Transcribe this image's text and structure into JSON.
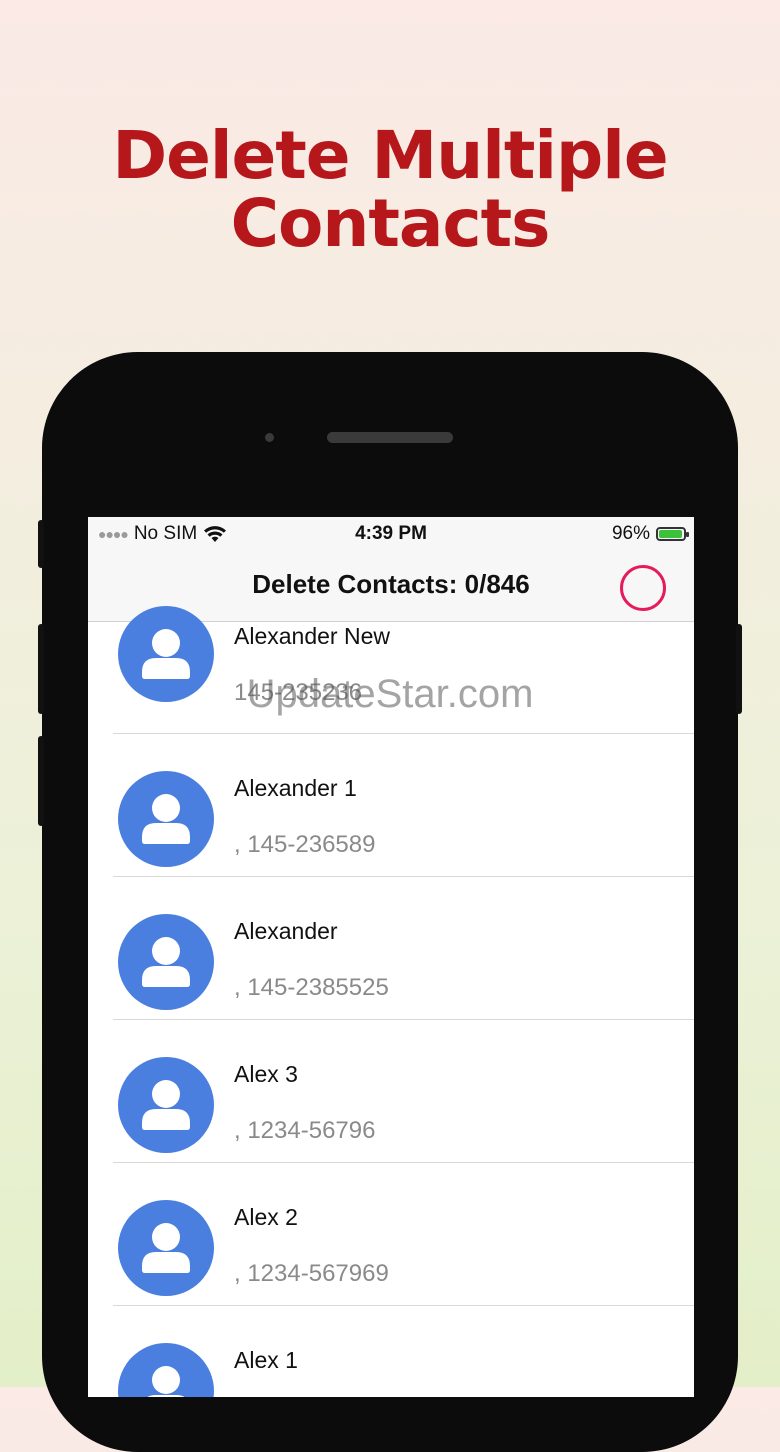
{
  "headline": {
    "line1": "Delete Multiple",
    "line2": "Contacts"
  },
  "status_bar": {
    "carrier": "No SIM",
    "time": "4:39 PM",
    "battery": "96%",
    "battery_level": 0.96
  },
  "nav": {
    "title": "Delete Contacts: 0/846",
    "select_all_icon": "circle-icon"
  },
  "contacts": [
    {
      "name": "Alexander New",
      "phone": "145-235236"
    },
    {
      "name": "Alexander 1",
      "phone": ", 145-236589"
    },
    {
      "name": "Alexander",
      "phone": ", 145-2385525"
    },
    {
      "name": "Alex 3",
      "phone": ", 1234-56796"
    },
    {
      "name": "Alex 2",
      "phone": ", 1234-567969"
    },
    {
      "name": "Alex 1",
      "phone": ""
    }
  ],
  "watermark": "UpdateStar.com",
  "colors": {
    "headline": "#b5171a",
    "avatar": "#4a7fe0",
    "select_ring": "#e51c5a",
    "battery_fill": "#3cc13b"
  }
}
